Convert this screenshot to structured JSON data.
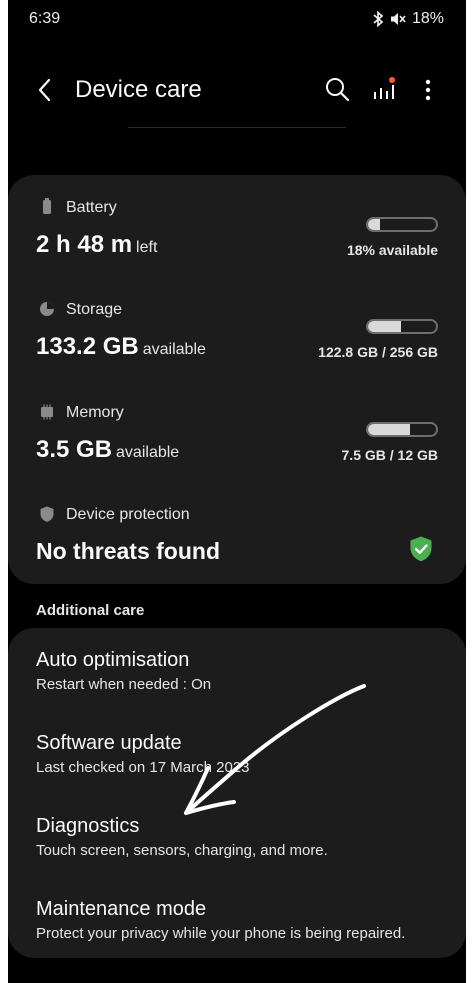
{
  "status": {
    "time": "6:39",
    "battery": "18%"
  },
  "header": {
    "title": "Device care"
  },
  "battery": {
    "label": "Battery",
    "value": "2 h 48 m",
    "suffix": "left",
    "bar_text": "18% available",
    "bar_level": 0.18
  },
  "storage": {
    "label": "Storage",
    "value": "133.2 GB",
    "suffix": "available",
    "bar_text": "122.8 GB / 256 GB",
    "bar_level": 0.48
  },
  "memory": {
    "label": "Memory",
    "value": "3.5 GB",
    "suffix": "available",
    "bar_text": "7.5 GB / 12 GB",
    "bar_level": 0.62
  },
  "protection": {
    "label": "Device protection",
    "value": "No threats found"
  },
  "additional": {
    "section_label": "Additional care",
    "items": [
      {
        "title": "Auto optimisation",
        "subtitle": "Restart when needed : On"
      },
      {
        "title": "Software update",
        "subtitle": "Last checked on 17 March 2023"
      },
      {
        "title": "Diagnostics",
        "subtitle": "Touch screen, sensors, charging, and more."
      },
      {
        "title": "Maintenance mode",
        "subtitle": "Protect your privacy while your phone is being repaired."
      }
    ]
  },
  "colors": {
    "background": "#000000",
    "card": "#1c1c1c",
    "shield_ok": "#4caf50",
    "notification_dot": "#ff5a2d"
  },
  "icons": [
    "back-arrow-icon",
    "search-icon",
    "stats-icon",
    "more-vertical-icon",
    "battery-icon",
    "storage-icon",
    "memory-icon",
    "shield-icon",
    "shield-check-icon",
    "bluetooth-icon",
    "mute-icon"
  ]
}
